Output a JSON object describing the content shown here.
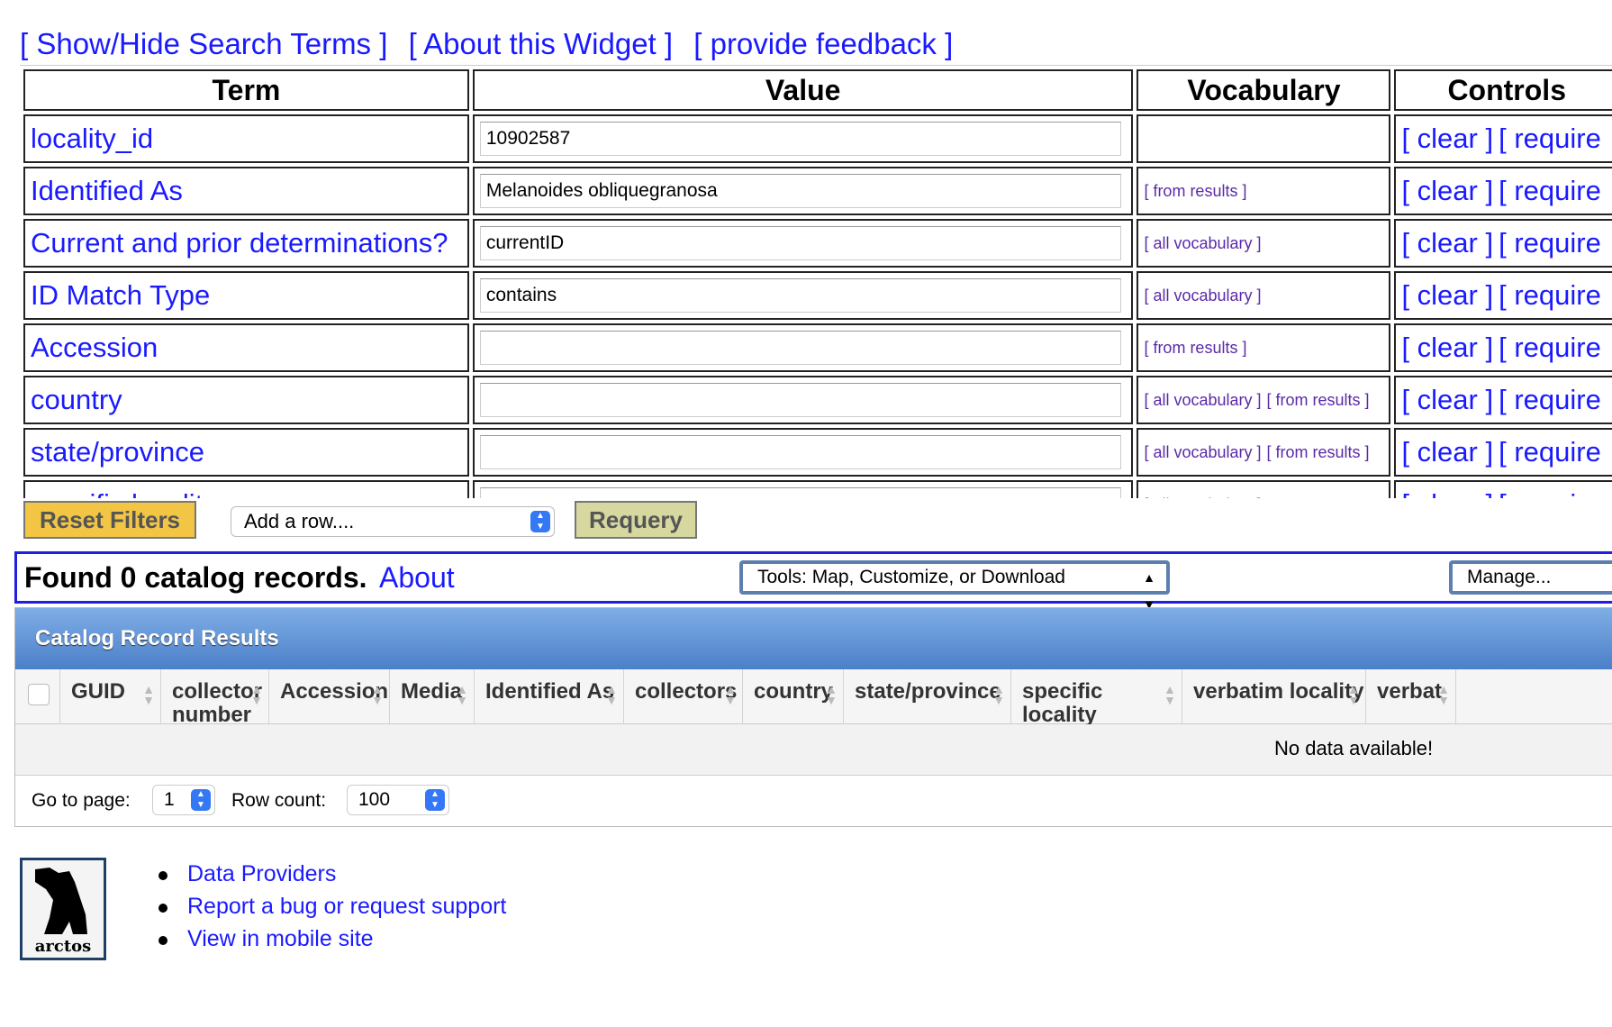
{
  "top_links": [
    "[ Show/Hide Search Terms ]",
    "[ About this Widget ]",
    "[ provide feedback ]"
  ],
  "terms_table": {
    "headers": {
      "term": "Term",
      "value": "Value",
      "vocabulary": "Vocabulary",
      "controls": "Controls"
    },
    "rows": [
      {
        "term": "locality_id",
        "value": "10902587",
        "vocab": [],
        "controls": [
          "[ clear ]",
          "[ require"
        ]
      },
      {
        "term": "Identified As",
        "value": "Melanoides obliquegranosa",
        "vocab": [
          "[ from results ]"
        ],
        "controls": [
          "[ clear ]",
          "[ require"
        ]
      },
      {
        "term": "Current and prior determinations?",
        "value": "currentID",
        "vocab": [
          "[ all vocabulary ]"
        ],
        "controls": [
          "[ clear ]",
          "[ require"
        ]
      },
      {
        "term": "ID Match Type",
        "value": "contains",
        "vocab": [
          "[ all vocabulary ]"
        ],
        "controls": [
          "[ clear ]",
          "[ require"
        ]
      },
      {
        "term": "Accession",
        "value": "",
        "vocab": [
          "[ from results ]"
        ],
        "controls": [
          "[ clear ]",
          "[ require"
        ]
      },
      {
        "term": "country",
        "value": "",
        "vocab": [
          "[ all vocabulary ]",
          "[ from results ]"
        ],
        "controls": [
          "[ clear ]",
          "[ require"
        ]
      },
      {
        "term": "state/province",
        "value": "",
        "vocab": [
          "[ all vocabulary ]",
          "[ from results ]"
        ],
        "controls": [
          "[ clear ]",
          "[ require"
        ]
      },
      {
        "term": "specific locality",
        "value": "",
        "vocab": [
          "[ all vocabulary ]"
        ],
        "controls": [
          "[ clear ]",
          "[ require"
        ]
      }
    ]
  },
  "filters": {
    "reset_label": "Reset Filters",
    "add_row_label": "Add a row....",
    "requery_label": "Requery"
  },
  "results_bar": {
    "found_text": "Found 0 catalog records.",
    "about_label": "About",
    "tools_label": "Tools: Map, Customize, or Download",
    "manage_label": "Manage..."
  },
  "grid": {
    "title": "Catalog Record Results",
    "columns": [
      "GUID",
      "collector number",
      "Accession",
      "Media",
      "Identified As",
      "collectors",
      "country",
      "state/province",
      "specific locality",
      "verbatim locality",
      "verbat"
    ],
    "empty_text": "No data available!",
    "pager": {
      "go_to_label": "Go to page:",
      "page_value": "1",
      "row_count_label": "Row count:",
      "row_count_value": "100"
    }
  },
  "footer": {
    "logo_text": "arctos",
    "links": [
      "Data Providers",
      "Report a bug or request support",
      "View in mobile site"
    ]
  },
  "colors": {
    "link": "#1a1aff",
    "vocab_link": "#5a2aa8",
    "reset_button": "#f2c545",
    "requery_button": "#d6d8a0",
    "results_border": "#1f1fdc",
    "grid_header": "#5b8fd4"
  }
}
